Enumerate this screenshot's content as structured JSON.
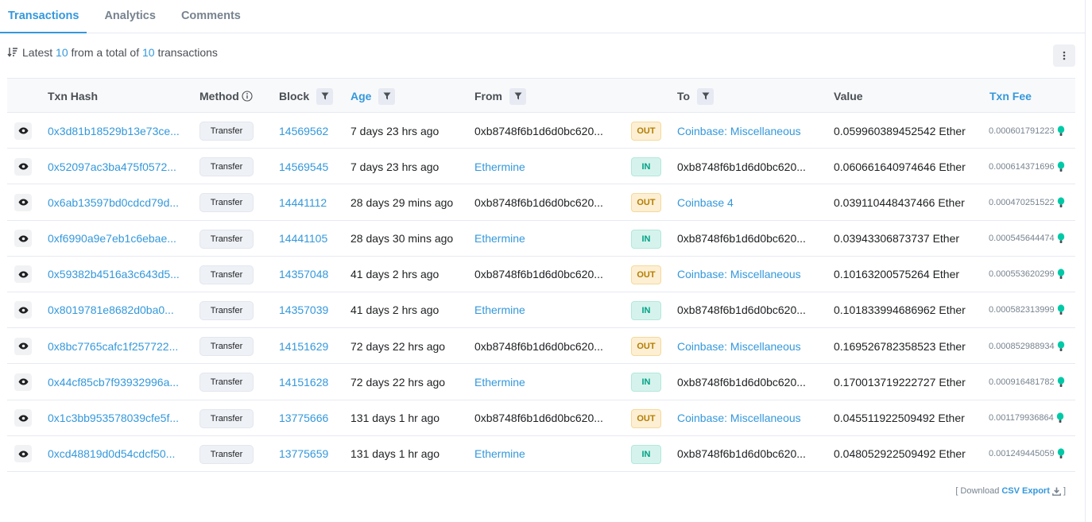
{
  "tabs": [
    {
      "label": "Transactions",
      "active": true
    },
    {
      "label": "Analytics",
      "active": false
    },
    {
      "label": "Comments",
      "active": false
    }
  ],
  "summary": {
    "prefix": "Latest",
    "shown": "10",
    "middle": "from a total of",
    "total": "10",
    "suffix": "transactions"
  },
  "columns": {
    "hash": "Txn Hash",
    "method": "Method",
    "block": "Block",
    "age": "Age",
    "from": "From",
    "to": "To",
    "value": "Value",
    "fee": "Txn Fee"
  },
  "rows": [
    {
      "hash": "0x3d81b18529b13e73ce...",
      "method": "Transfer",
      "block": "14569562",
      "age": "7 days 23 hrs ago",
      "from": "0xb8748f6b1d6d0bc620...",
      "from_link": false,
      "dir": "OUT",
      "to": "Coinbase: Miscellaneous",
      "to_link": true,
      "value": "0.059960389452542 Ether",
      "fee": "0.000601791223"
    },
    {
      "hash": "0x52097ac3ba475f0572...",
      "method": "Transfer",
      "block": "14569545",
      "age": "7 days 23 hrs ago",
      "from": "Ethermine",
      "from_link": true,
      "dir": "IN",
      "to": "0xb8748f6b1d6d0bc620...",
      "to_link": false,
      "value": "0.060661640974646 Ether",
      "fee": "0.000614371696"
    },
    {
      "hash": "0x6ab13597bd0cdcd79d...",
      "method": "Transfer",
      "block": "14441112",
      "age": "28 days 29 mins ago",
      "from": "0xb8748f6b1d6d0bc620...",
      "from_link": false,
      "dir": "OUT",
      "to": "Coinbase 4",
      "to_link": true,
      "value": "0.039110448437466 Ether",
      "fee": "0.000470251522"
    },
    {
      "hash": "0xf6990a9e7eb1c6ebae...",
      "method": "Transfer",
      "block": "14441105",
      "age": "28 days 30 mins ago",
      "from": "Ethermine",
      "from_link": true,
      "dir": "IN",
      "to": "0xb8748f6b1d6d0bc620...",
      "to_link": false,
      "value": "0.03943306873737 Ether",
      "fee": "0.000545644474"
    },
    {
      "hash": "0x59382b4516a3c643d5...",
      "method": "Transfer",
      "block": "14357048",
      "age": "41 days 2 hrs ago",
      "from": "0xb8748f6b1d6d0bc620...",
      "from_link": false,
      "dir": "OUT",
      "to": "Coinbase: Miscellaneous",
      "to_link": true,
      "value": "0.10163200575264 Ether",
      "fee": "0.000553620299"
    },
    {
      "hash": "0x8019781e8682d0ba0...",
      "method": "Transfer",
      "block": "14357039",
      "age": "41 days 2 hrs ago",
      "from": "Ethermine",
      "from_link": true,
      "dir": "IN",
      "to": "0xb8748f6b1d6d0bc620...",
      "to_link": false,
      "value": "0.101833994686962 Ether",
      "fee": "0.000582313999"
    },
    {
      "hash": "0x8bc7765cafc1f257722...",
      "method": "Transfer",
      "block": "14151629",
      "age": "72 days 22 hrs ago",
      "from": "0xb8748f6b1d6d0bc620...",
      "from_link": false,
      "dir": "OUT",
      "to": "Coinbase: Miscellaneous",
      "to_link": true,
      "value": "0.169526782358523 Ether",
      "fee": "0.000852988934"
    },
    {
      "hash": "0x44cf85cb7f93932996a...",
      "method": "Transfer",
      "block": "14151628",
      "age": "72 days 22 hrs ago",
      "from": "Ethermine",
      "from_link": true,
      "dir": "IN",
      "to": "0xb8748f6b1d6d0bc620...",
      "to_link": false,
      "value": "0.170013719222727 Ether",
      "fee": "0.000916481782"
    },
    {
      "hash": "0x1c3bb953578039cfe5f...",
      "method": "Transfer",
      "block": "13775666",
      "age": "131 days 1 hr ago",
      "from": "0xb8748f6b1d6d0bc620...",
      "from_link": false,
      "dir": "OUT",
      "to": "Coinbase: Miscellaneous",
      "to_link": true,
      "value": "0.045511922509492 Ether",
      "fee": "0.001179936864"
    },
    {
      "hash": "0xcd48819d0d54cdcf50...",
      "method": "Transfer",
      "block": "13775659",
      "age": "131 days 1 hr ago",
      "from": "Ethermine",
      "from_link": true,
      "dir": "IN",
      "to": "0xb8748f6b1d6d0bc620...",
      "to_link": false,
      "value": "0.048052922509492 Ether",
      "fee": "0.001249445059"
    }
  ],
  "footer": {
    "open": "[ Download",
    "csv": "CSV Export",
    "close": "]"
  },
  "colors": {
    "accent": "#3498db",
    "out_bg": "#fcefd3",
    "in_bg": "#d5f3ec",
    "gas": "#00c9a7"
  }
}
